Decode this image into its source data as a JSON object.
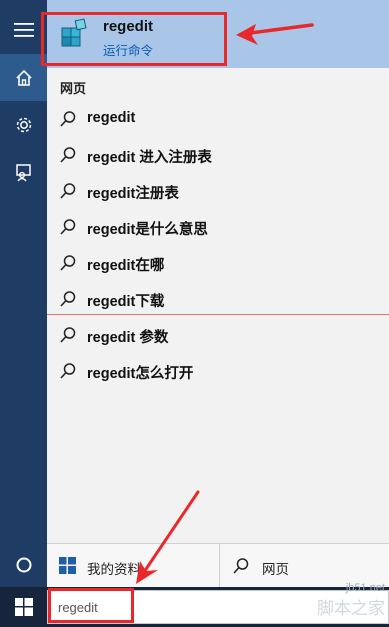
{
  "best_match": {
    "title": "regedit",
    "subtitle": "运行命令",
    "icon": "regedit-app-icon"
  },
  "section": {
    "heading": "网页"
  },
  "suggestions": [
    "regedit",
    "regedit 进入注册表",
    "regedit注册表",
    "regedit是什么意思",
    "regedit在哪",
    "regedit下载",
    "regedit 参数",
    "regedit怎么打开"
  ],
  "rail": {
    "items": [
      "hamburger-menu-icon",
      "home-icon",
      "gear-icon",
      "feedback-icon"
    ],
    "bottom_icon": "cortana-circle-icon"
  },
  "filters": {
    "mine_label": "我的资料",
    "web_label": "网页"
  },
  "searchbox": {
    "value": "regedit"
  },
  "watermark": {
    "url": "jb51.net",
    "text": "脚本之家"
  },
  "colors": {
    "rail": "#1f3d64",
    "best_match_bg": "#a9c6e8",
    "annotation_red": "#e8282a",
    "link_blue": "#0b5bb5"
  }
}
